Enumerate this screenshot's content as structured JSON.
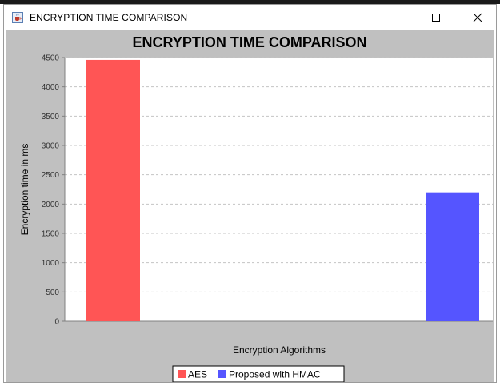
{
  "window": {
    "title": "ENCRYPTION TIME COMPARISON",
    "icon": "java-cup-icon",
    "controls": {
      "minimize": "minimize-icon",
      "maximize": "maximize-icon",
      "close": "close-icon"
    }
  },
  "colors": {
    "aes": "#ff5555",
    "hmac": "#5555ff",
    "panel": "#c0c0c0",
    "plot": "#ffffff"
  },
  "chart_data": {
    "type": "bar",
    "title": "ENCRYPTION TIME COMPARISON",
    "xlabel": "Encryption Algorithms",
    "ylabel": "Encryption time in ms",
    "ylim": [
      0,
      4500
    ],
    "yticks": [
      0,
      500,
      1000,
      1500,
      2000,
      2500,
      3000,
      3500,
      4000,
      4500
    ],
    "grid": true,
    "legend_position": "bottom",
    "series": [
      {
        "name": "AES",
        "values": [
          4460
        ],
        "color": "#ff5555"
      },
      {
        "name": "Proposed with HMAC",
        "values": [
          2200
        ],
        "color": "#5555ff"
      }
    ]
  }
}
